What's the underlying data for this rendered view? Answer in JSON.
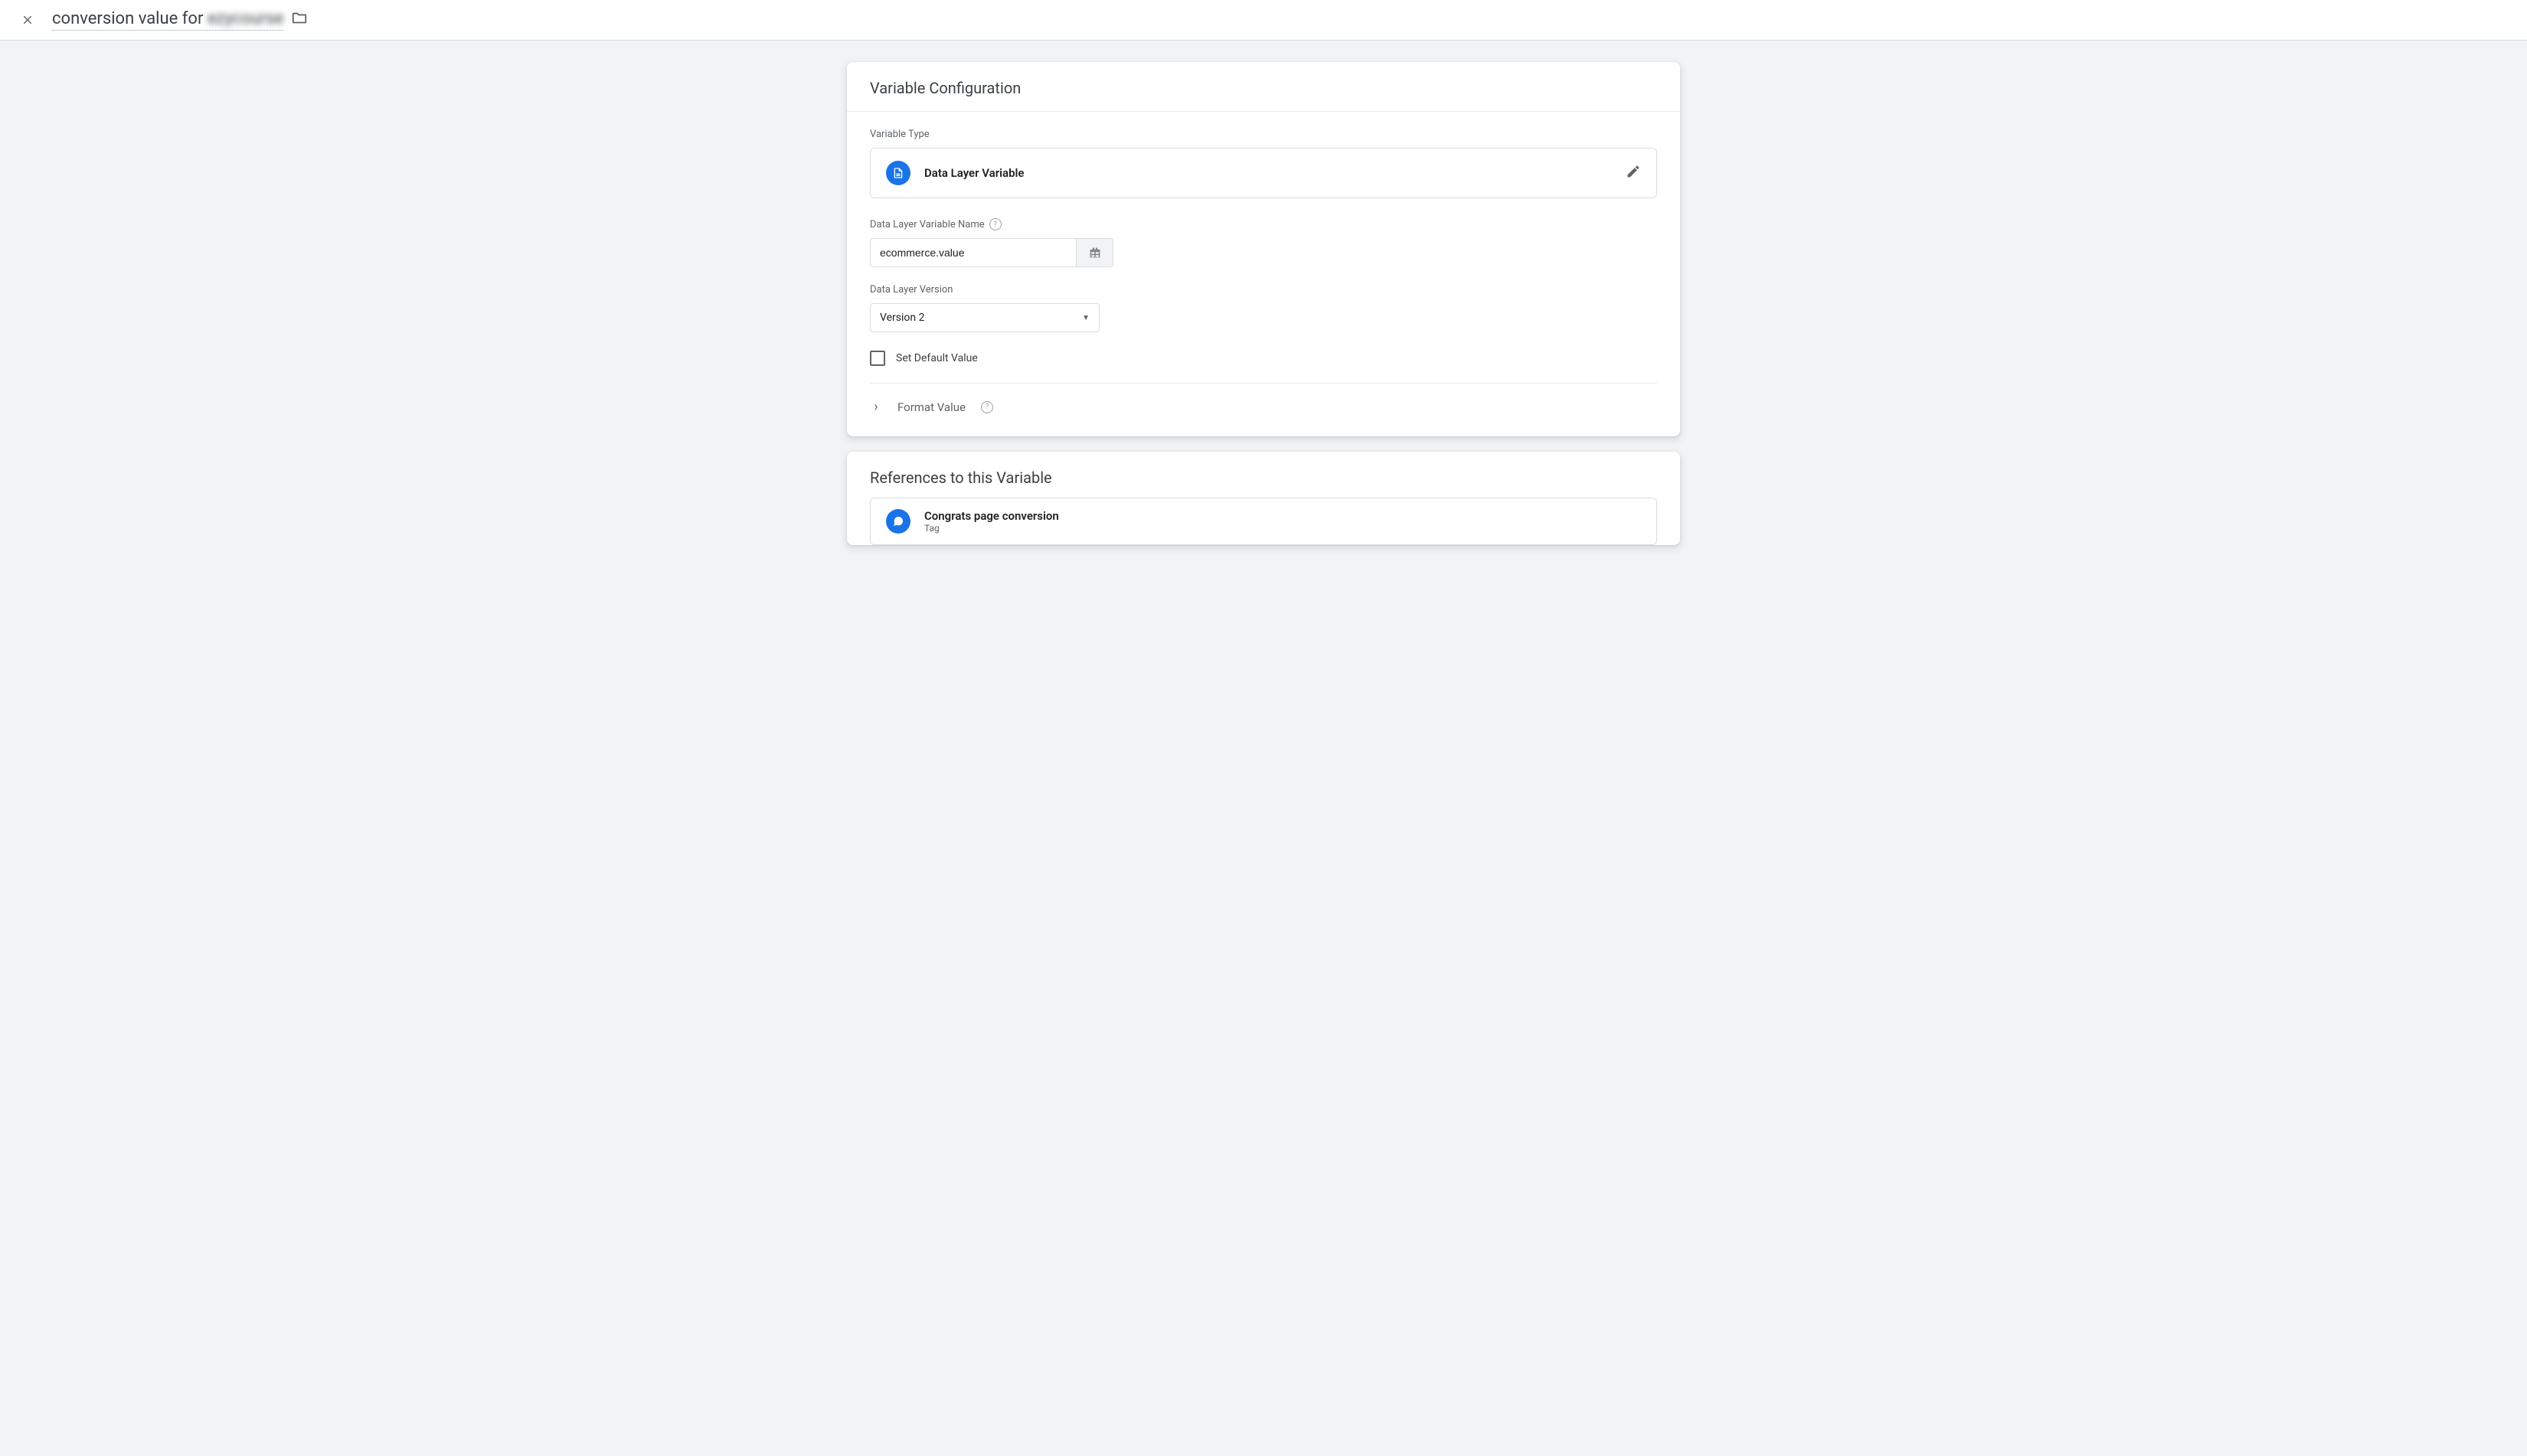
{
  "header": {
    "title_prefix": "conversion value for ",
    "title_blurred": "ezycourse"
  },
  "config": {
    "section_title": "Variable Configuration",
    "type_label": "Variable Type",
    "type_name": "Data Layer Variable",
    "name_label": "Data Layer Variable Name",
    "name_value": "ecommerce.value",
    "version_label": "Data Layer Version",
    "version_value": "Version 2",
    "default_checkbox": "Set Default Value",
    "format_label": "Format Value"
  },
  "references": {
    "section_title": "References to this Variable",
    "items": [
      {
        "name": "Congrats page conversion",
        "type": "Tag"
      }
    ]
  }
}
